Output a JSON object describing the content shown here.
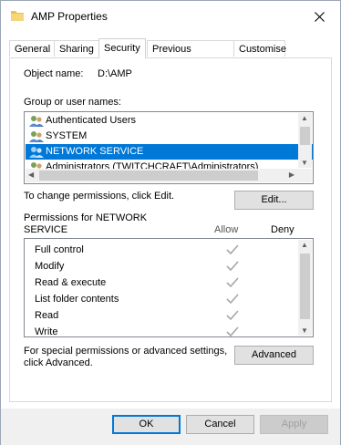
{
  "window": {
    "title": "AMP Properties",
    "icon": "folder-icon",
    "close_icon": "close-icon"
  },
  "tabs": [
    {
      "label": "General"
    },
    {
      "label": "Sharing"
    },
    {
      "label": "Security",
      "active": true
    },
    {
      "label": "Previous Versions"
    },
    {
      "label": "Customise"
    }
  ],
  "object": {
    "label": "Object name:",
    "value": "D:\\AMP"
  },
  "groups": {
    "label": "Group or user names:",
    "items": [
      {
        "name": "Authenticated Users",
        "icon": "users-icon"
      },
      {
        "name": "SYSTEM",
        "icon": "users-icon"
      },
      {
        "name": "NETWORK SERVICE",
        "icon": "users-icon",
        "selected": true
      },
      {
        "name": "Administrators (TWITCHCRAFT\\Administrators)",
        "icon": "users-icon"
      }
    ]
  },
  "change_permissions": {
    "text": "To change permissions, click Edit.",
    "button": "Edit..."
  },
  "permissions": {
    "title_line1": "Permissions for NETWORK",
    "title_line2": "SERVICE",
    "allow_header": "Allow",
    "deny_header": "Deny",
    "rows": [
      {
        "name": "Full control",
        "allow": true,
        "deny": false
      },
      {
        "name": "Modify",
        "allow": true,
        "deny": false
      },
      {
        "name": "Read & execute",
        "allow": true,
        "deny": false
      },
      {
        "name": "List folder contents",
        "allow": true,
        "deny": false
      },
      {
        "name": "Read",
        "allow": true,
        "deny": false
      },
      {
        "name": "Write",
        "allow": true,
        "deny": false
      }
    ]
  },
  "advanced": {
    "text_line1": "For special permissions or advanced settings,",
    "text_line2": "click Advanced.",
    "button": "Advanced"
  },
  "footer": {
    "ok": "OK",
    "cancel": "Cancel",
    "apply": "Apply"
  },
  "colors": {
    "selection": "#0078d7",
    "disabled_text": "#a0a0a0",
    "check_gray": "#a8a8a8"
  }
}
